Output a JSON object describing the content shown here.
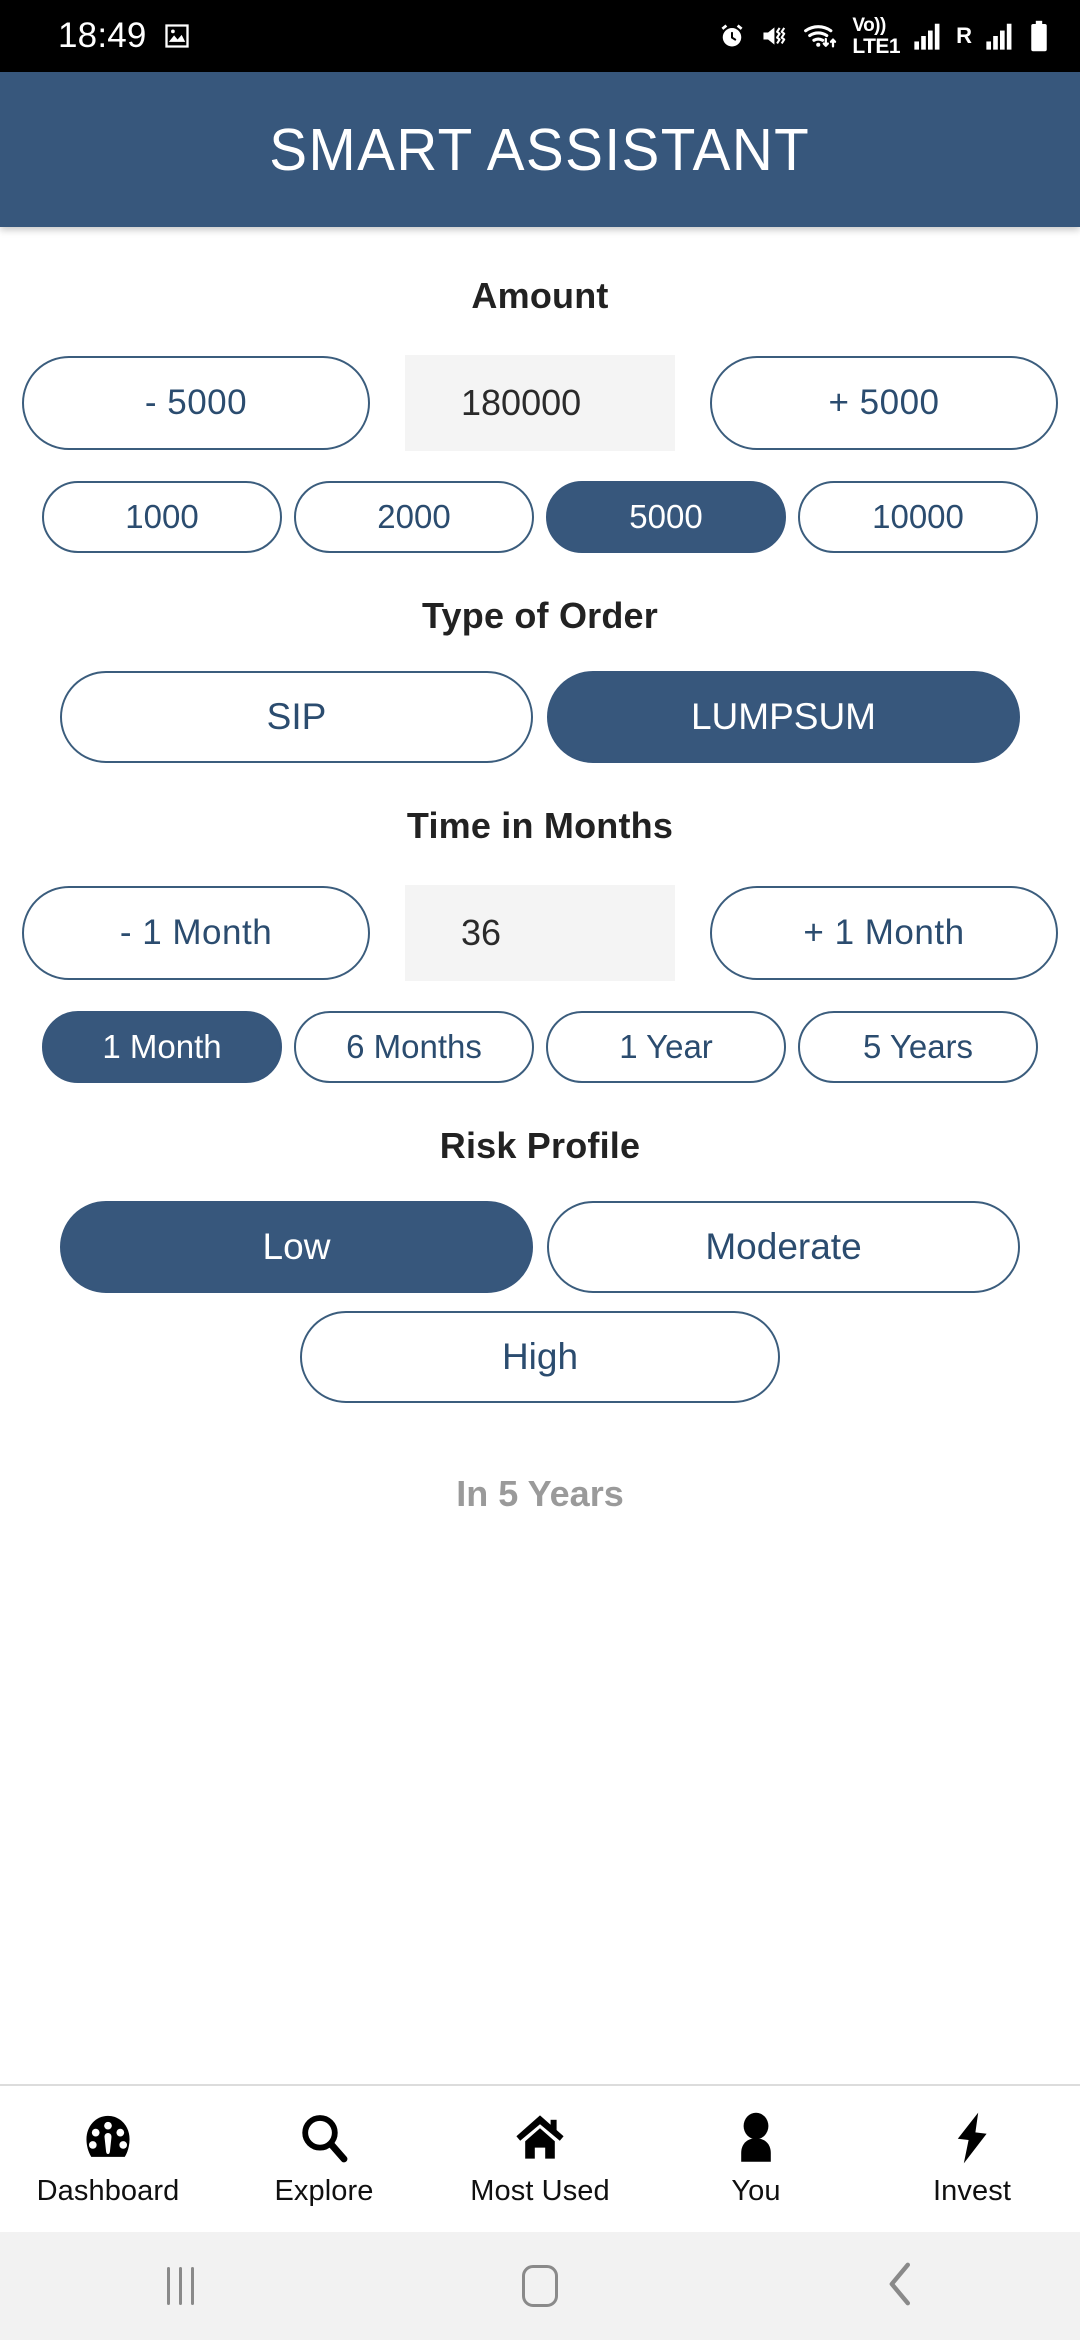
{
  "status_bar": {
    "time": "18:49",
    "left_icons": [
      "image-icon"
    ],
    "right_icons": [
      "alarm-icon",
      "vibrate-icon",
      "wifi-icon",
      "signal-bars-icon",
      "signal-bars-icon",
      "battery-icon"
    ],
    "volte_top": "Vo))",
    "volte_bottom": "LTE1",
    "roaming_letter": "R"
  },
  "header": {
    "title": "SMART ASSISTANT",
    "background_color": "#37577C",
    "text_color": "#FFFFFF"
  },
  "theme": {
    "accent": "#37577C",
    "outline": "#3B5D7D",
    "outline_text": "#2B4C6F",
    "field_bg": "#F4F4F4",
    "muted_text": "#9A9A9A"
  },
  "amount": {
    "heading": "Amount",
    "decrement_label": "- 5000",
    "value": "180000",
    "increment_label": "+ 5000",
    "presets": [
      {
        "label": "1000",
        "selected": false
      },
      {
        "label": "2000",
        "selected": false
      },
      {
        "label": "5000",
        "selected": true
      },
      {
        "label": "10000",
        "selected": false
      }
    ]
  },
  "order_type": {
    "heading": "Type of Order",
    "options": [
      {
        "label": "SIP",
        "selected": false
      },
      {
        "label": "LUMPSUM",
        "selected": true
      }
    ]
  },
  "time_months": {
    "heading": "Time in Months",
    "decrement_label": "- 1 Month",
    "value": "36",
    "increment_label": "+ 1 Month",
    "presets": [
      {
        "label": "1 Month",
        "selected": true
      },
      {
        "label": "6 Months",
        "selected": false
      },
      {
        "label": "1 Year",
        "selected": false
      },
      {
        "label": "5 Years",
        "selected": false
      }
    ]
  },
  "risk_profile": {
    "heading": "Risk Profile",
    "options_row1": [
      {
        "label": "Low",
        "selected": true
      },
      {
        "label": "Moderate",
        "selected": false
      }
    ],
    "options_row2": [
      {
        "label": "High",
        "selected": false
      }
    ]
  },
  "footnote": "In 5 Years",
  "bottom_nav": [
    {
      "label": "Dashboard",
      "icon": "gauge-icon"
    },
    {
      "label": "Explore",
      "icon": "search-icon"
    },
    {
      "label": "Most Used",
      "icon": "home-icon"
    },
    {
      "label": "You",
      "icon": "person-icon"
    },
    {
      "label": "Invest",
      "icon": "lightning-icon"
    }
  ],
  "android_nav": {
    "recents": "recents-icon",
    "home": "home-button-icon",
    "back": "back-icon"
  }
}
